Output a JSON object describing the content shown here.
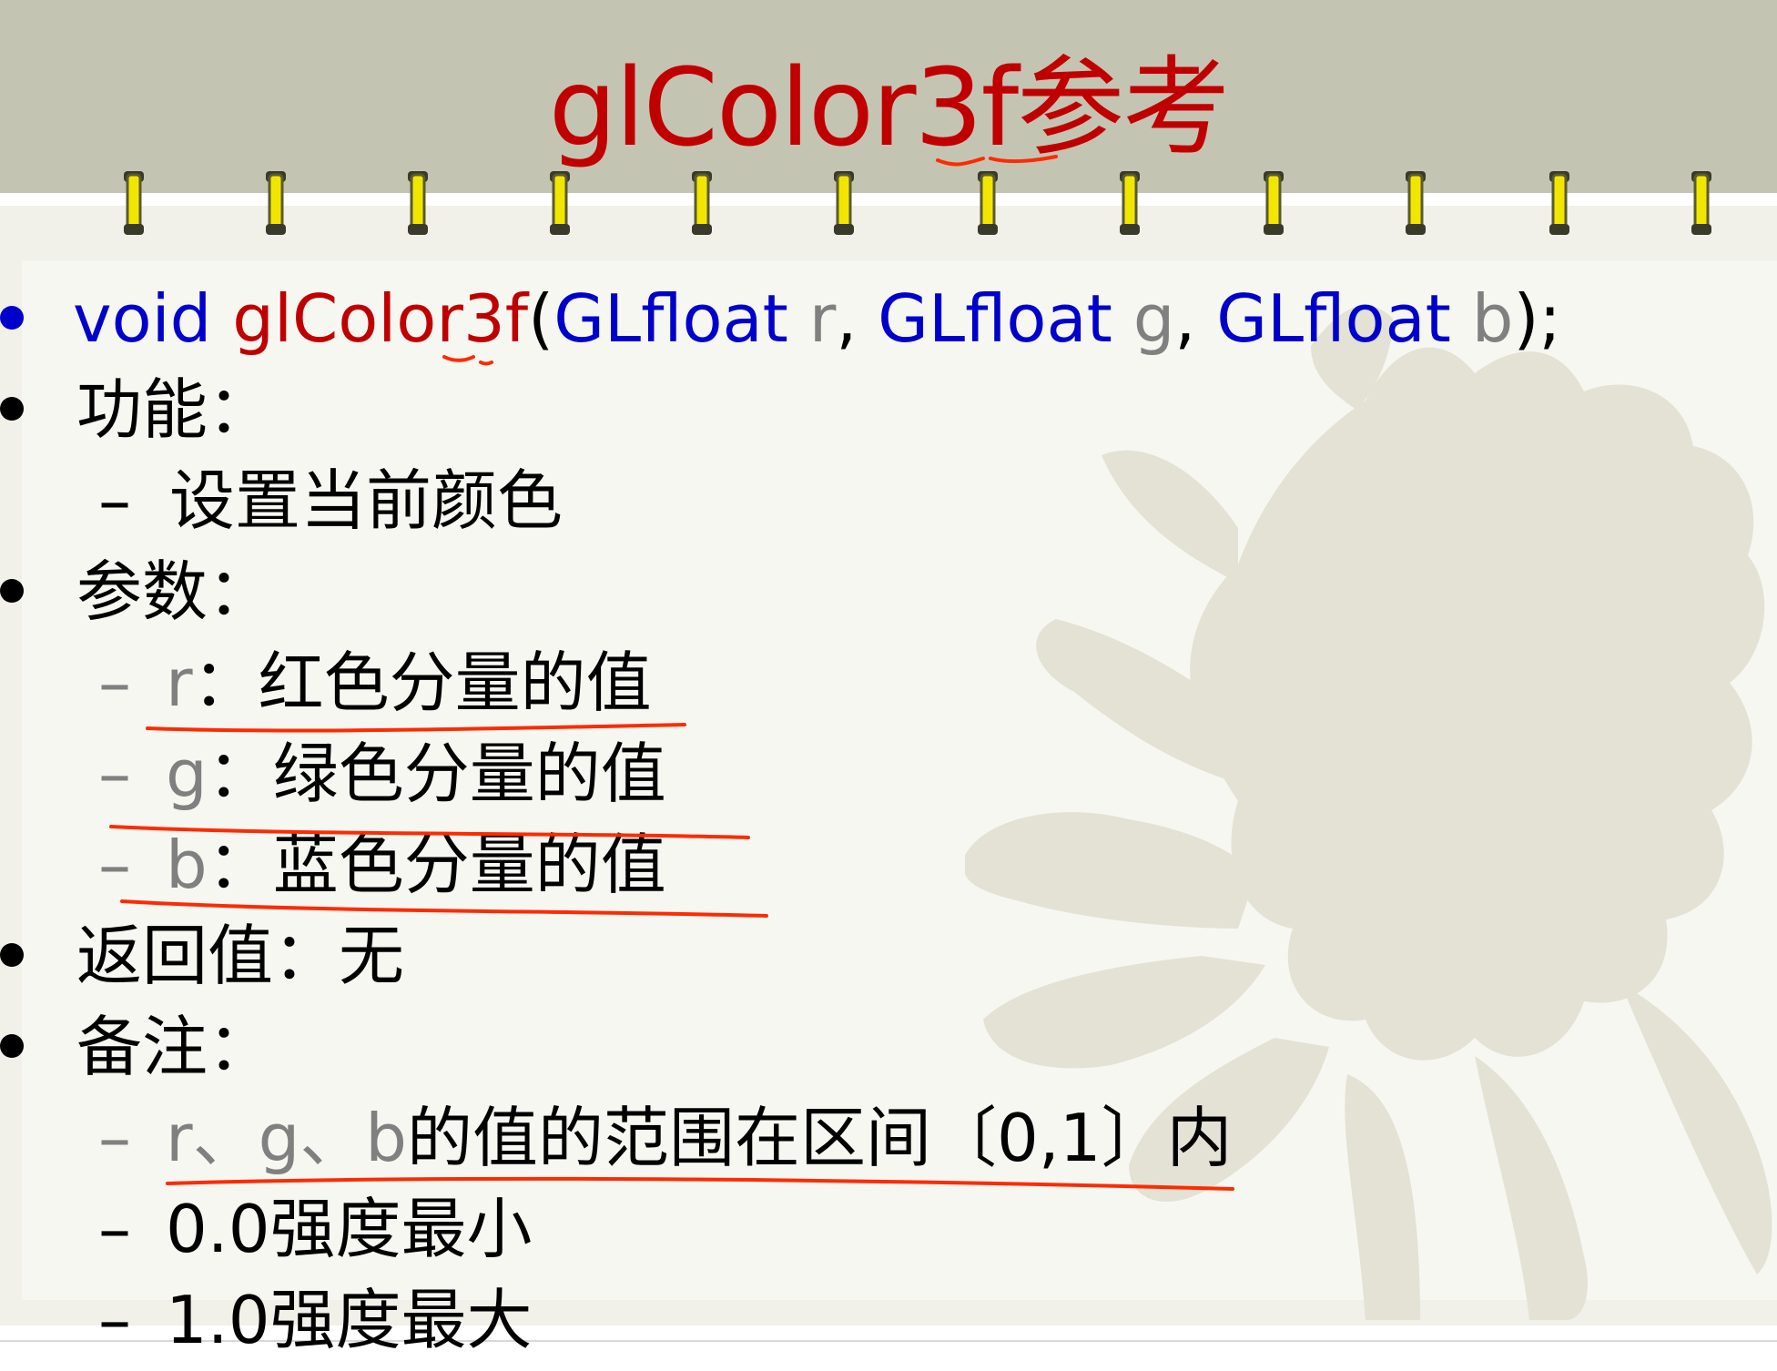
{
  "title": {
    "code": "glColor3f",
    "cn": "参考"
  },
  "signature": {
    "void": "void",
    "func": "glColor3f",
    "open": "(",
    "t1": "GLfloat",
    "p1": "r",
    "c1": ",",
    "t2": "GLfloat",
    "p2": "g",
    "c2": ",",
    "t3": "GLfloat",
    "p3": "b",
    "close": ");"
  },
  "function_label": "功能：",
  "function_desc": "设置当前颜色",
  "params_label": "参数：",
  "params": [
    {
      "name": "r",
      "sep": "：",
      "desc": "红色分量的值"
    },
    {
      "name": "g",
      "sep": "：",
      "desc": "绿色分量的值"
    },
    {
      "name": "b",
      "sep": "：",
      "desc": "蓝色分量的值"
    }
  ],
  "return_label": "返回值：",
  "return_value": "无",
  "notes_label": "备注：",
  "note1": {
    "vars": "r、g、b",
    "desc": "的值的范围在区间〔0,1〕内"
  },
  "note2": {
    "value": "0.0",
    "desc": "强度最小"
  },
  "note3": {
    "value": "1.0",
    "desc": "强度最大"
  },
  "dash": "–",
  "colors": {
    "header": "#c4c4b3",
    "title": "#c00000",
    "type": "#0000cc",
    "param": "#808080",
    "annotation": "#ff2a00",
    "ring": "#f2e600"
  }
}
